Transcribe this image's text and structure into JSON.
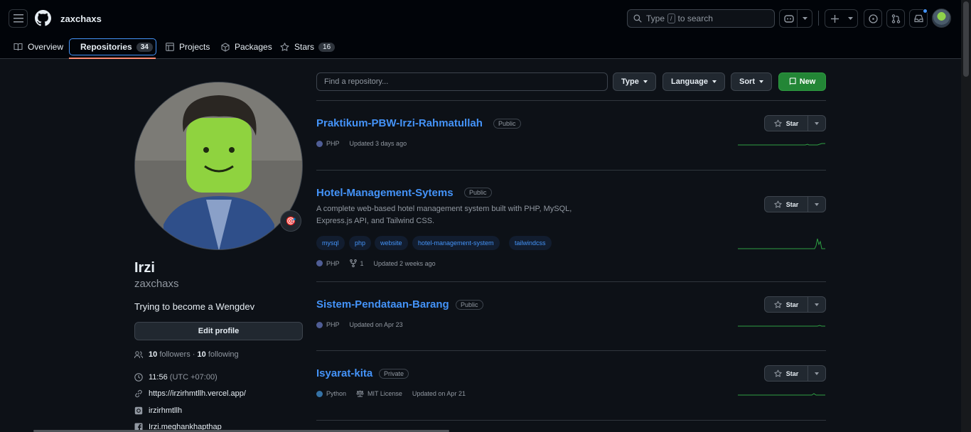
{
  "header": {
    "username": "zaxchaxs",
    "search_prefix": "Type",
    "search_key": "/",
    "search_suffix": "to search"
  },
  "tabs": [
    {
      "label": "Overview",
      "icon": "book-icon"
    },
    {
      "label": "Repositories",
      "count": "34",
      "icon": "repo-icon"
    },
    {
      "label": "Projects",
      "icon": "table-icon"
    },
    {
      "label": "Packages",
      "icon": "package-icon"
    },
    {
      "label": "Stars",
      "count": "16",
      "icon": "star-icon"
    }
  ],
  "profile": {
    "name": "Irzi",
    "login": "zaxchaxs",
    "bio": "Trying to become a Wengdev",
    "status_emoji": "🎯",
    "edit_label": "Edit profile",
    "followers_count": "10",
    "followers_label": "followers",
    "dot": "·",
    "following_count": "10",
    "following_label": "following",
    "time": "11:56",
    "timezone": "(UTC +07:00)",
    "website": "https://irzirhmtllh.vercel.app/",
    "instagram": "irzirhmtllh",
    "facebook": "Irzi.meghankhapthap"
  },
  "filters": {
    "find_placeholder": "Find a repository...",
    "type_label": "Type",
    "language_label": "Language",
    "sort_label": "Sort",
    "new_label": "New"
  },
  "repos": [
    {
      "name": "Praktikum-PBW-Irzi-Rahmatullah",
      "visibility": "Public",
      "language": "PHP",
      "updated": "Updated 3 days ago",
      "star_label": "Star"
    },
    {
      "name": "Hotel-Management-Sytems",
      "visibility": "Public",
      "description_line1": "A complete web-based hotel management system built with PHP, MySQL,",
      "description_line2": "Express.js API, and Tailwind CSS.",
      "topics": [
        "mysql",
        "php",
        "website",
        "hotel-management-system",
        "tailwindcss"
      ],
      "language": "PHP",
      "forks": "1",
      "updated": "Updated 2 weeks ago",
      "star_label": "Star"
    },
    {
      "name": "Sistem-Pendataan-Barang",
      "visibility": "Public",
      "language": "PHP",
      "updated": "Updated on Apr 23",
      "star_label": "Star"
    },
    {
      "name": "Isyarat-kita",
      "visibility": "Private",
      "language": "Python",
      "license": "MIT License",
      "updated": "Updated on Apr 21",
      "star_label": "Star"
    }
  ],
  "colors": {
    "php": "#4f5d95",
    "python": "#3572a5",
    "accent": "#4493f8",
    "new_button": "#238636",
    "tab_underline": "#fd8c73"
  }
}
